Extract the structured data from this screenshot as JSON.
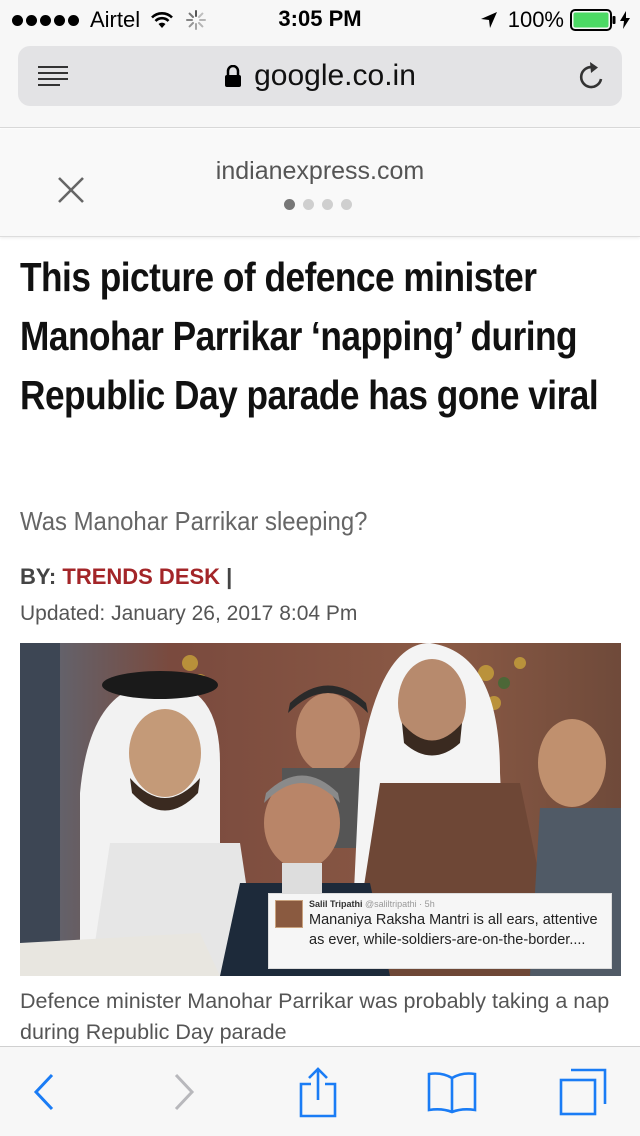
{
  "status_bar": {
    "carrier": "Airtel",
    "time": "3:05 PM",
    "battery": "100%",
    "signal_icon": "signal-dots-icon",
    "wifi_icon": "wifi-icon",
    "loading_icon": "activity-spinner-icon",
    "location_icon": "location-arrow-icon",
    "battery_icon": "battery-icon",
    "battery_color": "#4cd964"
  },
  "url_bar": {
    "domain": "google.co.in",
    "reader_icon": "reader-list-icon",
    "lock_icon": "lock-icon",
    "reload_icon": "reload-icon"
  },
  "amp_header": {
    "source_domain": "indianexpress.com",
    "close_icon": "close-icon",
    "page_dots": 4,
    "active_dot": 1
  },
  "article": {
    "headline": "This picture of defence minister Manohar Parrikar ‘napping’ during Republic Day parade has gone viral",
    "subheadline": "Was Manohar Parrikar sleeping?",
    "byline_prefix": "BY: ",
    "author": "TRENDS DESK",
    "byline_suffix": " |",
    "updated": "Updated: January 26, 2017 8:04 Pm",
    "author_color": "#a32528",
    "image": {
      "tweet_name": "Salil Tripathi",
      "tweet_handle": "@saliltripathi · 5h",
      "tweet_text": "Mananiya Raksha Mantri is all ears, attentive as ever, while-soldiers-are-on-the-border...."
    },
    "caption": "Defence minister Manohar Parrikar was probably taking a nap during Republic Day parade"
  },
  "toolbar": {
    "back_icon": "back-chevron-icon",
    "forward_icon": "forward-chevron-icon",
    "share_icon": "share-icon",
    "bookmarks_icon": "bookmarks-book-icon",
    "tabs_icon": "tabs-icon",
    "accent": "#1a7cf5"
  }
}
